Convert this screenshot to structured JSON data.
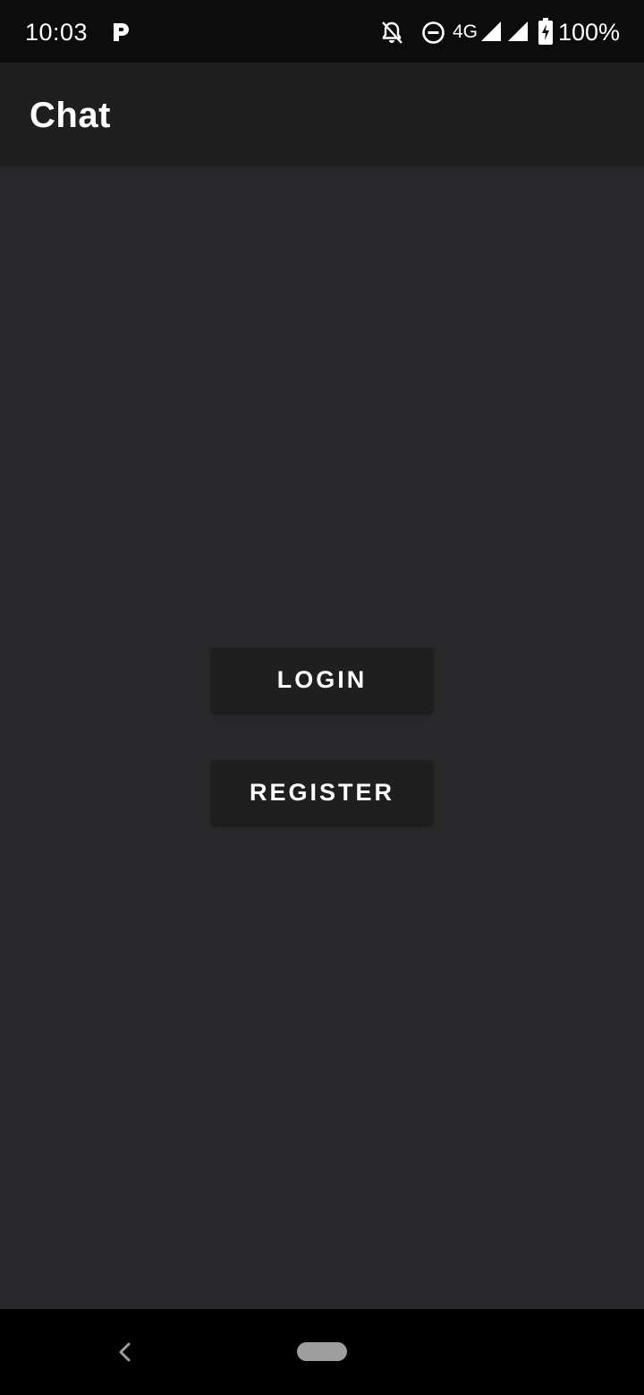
{
  "status_bar": {
    "time": "10:03",
    "network": "4G",
    "battery": "100%",
    "icons": [
      "parking-icon",
      "notifications-off-icon",
      "do-not-disturb-icon",
      "signal-icon",
      "signal-icon",
      "battery-charging-icon"
    ]
  },
  "app_bar": {
    "title": "Chat"
  },
  "main": {
    "login_label": "LOGIN",
    "register_label": "REGISTER"
  },
  "nav_bar": {
    "icons": [
      "back-icon",
      "home-pill-icon"
    ]
  },
  "colors": {
    "status_bar_bg": "#0c0c0c",
    "app_bar_bg": "#1f1f1f",
    "screen_bg": "#28282a",
    "button_bg": "#1f1f1f",
    "text": "#ffffff",
    "nav_bar_bg": "#000000"
  }
}
